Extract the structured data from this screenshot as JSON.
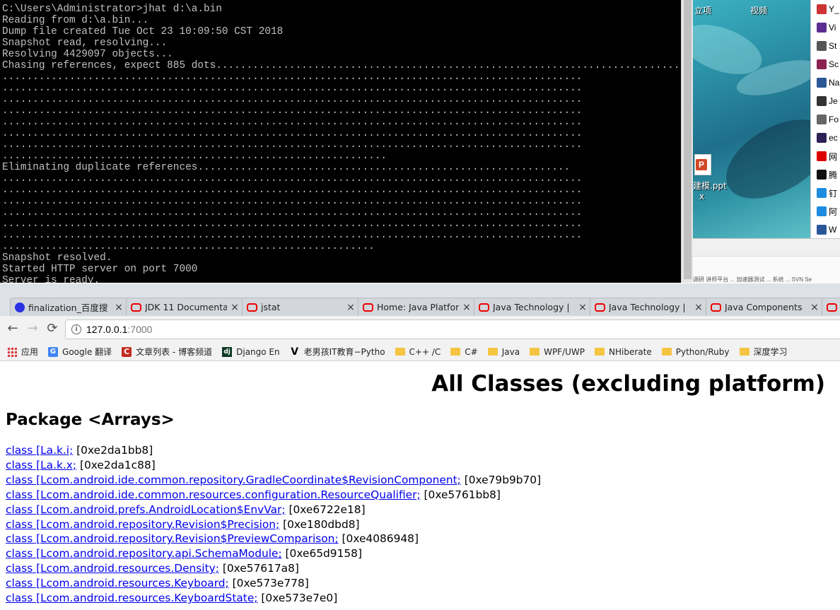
{
  "console": {
    "lines": [
      "C:\\Users\\Administrator>jhat d:\\a.bin",
      "Reading from d:\\a.bin...",
      "Dump file created Tue Oct 23 10:09:50 CST 2018",
      "Snapshot read, resolving...",
      "Resolving 4429097 objects...",
      "Chasing references, expect 885 dots.......................................................................................",
      "...............................................................................................",
      "...............................................................................................",
      "...............................................................................................",
      "...............................................................................................",
      "...............................................................................................",
      "...............................................................................................",
      "...............................................................................................",
      "...............................................................",
      "Eliminating duplicate references.............................................................",
      "...............................................................................................",
      "...............................................................................................",
      "...............................................................................................",
      "...............................................................................................",
      "...............................................................................................",
      "...............................................................................................",
      ".............................................................",
      "Snapshot resolved.",
      "Started HTTP server on port 7000",
      "Server is ready."
    ]
  },
  "desktop": {
    "labels": {
      "top_left": "立项",
      "top_right": "视频",
      "ppt_name": "建模.ppt",
      "ppt_sub": "x"
    },
    "strip_text": "调研 讲师平台 ... 加速器测试 ... 系统 ... SVN Se"
  },
  "right_list": {
    "items": [
      {
        "label": "Y_",
        "icon_color": "#c33",
        "icon": "pdf-icon"
      },
      {
        "label": "Vi",
        "icon_color": "#5c2d91",
        "icon": "vs-icon"
      },
      {
        "label": "St",
        "icon_color": "#555",
        "icon": "app-icon"
      },
      {
        "label": "Sc",
        "icon_color": "#8b2252",
        "icon": "app-icon"
      },
      {
        "label": "Na",
        "icon_color": "#2b5797",
        "icon": "app-icon"
      },
      {
        "label": "Je",
        "icon_color": "#333",
        "icon": "jetbrains-icon"
      },
      {
        "label": "Fo",
        "icon_color": "#666",
        "icon": "app-icon"
      },
      {
        "label": "ec",
        "icon_color": "#2c2255",
        "icon": "eclipse-icon"
      },
      {
        "label": "网",
        "icon_color": "#d00",
        "icon": "app-icon"
      },
      {
        "label": "腾",
        "icon_color": "#111",
        "icon": "qq-icon"
      },
      {
        "label": "钉",
        "icon_color": "#1d8ce0",
        "icon": "dingtalk-icon"
      },
      {
        "label": "阿",
        "icon_color": "#1d8ce0",
        "icon": "app-icon"
      },
      {
        "label": "W",
        "icon_color": "#2b579a",
        "icon": "word-icon"
      }
    ]
  },
  "browser": {
    "tabs": [
      {
        "label": "finalization_百度搜",
        "icon": "baidu",
        "active": false
      },
      {
        "label": "JDK 11 Documenta",
        "icon": "oracle",
        "active": false
      },
      {
        "label": "jstat",
        "icon": "oracle",
        "active": false
      },
      {
        "label": "Home: Java Platfor",
        "icon": "oracle",
        "active": false
      },
      {
        "label": "Java Technology |",
        "icon": "oracle",
        "active": false
      },
      {
        "label": "Java Technology |",
        "icon": "oracle",
        "active": false
      },
      {
        "label": "Java Components",
        "icon": "oracle",
        "active": false
      },
      {
        "label": "",
        "icon": "oracle",
        "active": false
      }
    ],
    "tab_close": "×",
    "nav": {
      "back": "←",
      "forward": "→",
      "reload": "⟳",
      "info": "i"
    },
    "url": {
      "host": "127.0.0.1",
      "port": ":7000"
    },
    "bookmarks": [
      {
        "label": "应用",
        "icon": "apps"
      },
      {
        "label": "Google 翻译",
        "icon": "google"
      },
      {
        "label": "文章列表 - 博客频道",
        "icon": "csdn"
      },
      {
        "label": "Django En",
        "icon": "dj"
      },
      {
        "label": "老男孩IT教育−Pytho",
        "icon": "v"
      },
      {
        "label": "C++ /C",
        "icon": "folder"
      },
      {
        "label": "C#",
        "icon": "folder"
      },
      {
        "label": "Java",
        "icon": "folder"
      },
      {
        "label": "WPF/UWP",
        "icon": "folder"
      },
      {
        "label": "NHiberate",
        "icon": "folder"
      },
      {
        "label": "Python/Ruby",
        "icon": "folder"
      },
      {
        "label": "深度学习",
        "icon": "folder"
      }
    ]
  },
  "page": {
    "title": "All Classes (excluding platform)",
    "package_heading": "Package <Arrays>",
    "classes": [
      {
        "link": "class [La.k.i;",
        "addr": " [0xe2da1bb8]"
      },
      {
        "link": "class [La.k.x;",
        "addr": " [0xe2da1c88]"
      },
      {
        "link": "class [Lcom.android.ide.common.repository.GradleCoordinate$RevisionComponent;",
        "addr": " [0xe79b9b70]"
      },
      {
        "link": "class [Lcom.android.ide.common.resources.configuration.ResourceQualifier;",
        "addr": " [0xe5761bb8]"
      },
      {
        "link": "class [Lcom.android.prefs.AndroidLocation$EnvVar;",
        "addr": " [0xe6722e18]"
      },
      {
        "link": "class [Lcom.android.repository.Revision$Precision;",
        "addr": " [0xe180dbd8]"
      },
      {
        "link": "class [Lcom.android.repository.Revision$PreviewComparison;",
        "addr": " [0xe4086948]"
      },
      {
        "link": "class [Lcom.android.repository.api.SchemaModule;",
        "addr": " [0xe65d9158]"
      },
      {
        "link": "class [Lcom.android.resources.Density;",
        "addr": " [0xe57617a8]"
      },
      {
        "link": "class [Lcom.android.resources.Keyboard;",
        "addr": " [0xe573e778]"
      },
      {
        "link": "class [Lcom.android.resources.KeyboardState;",
        "addr": " [0xe573e7e0]"
      }
    ]
  }
}
